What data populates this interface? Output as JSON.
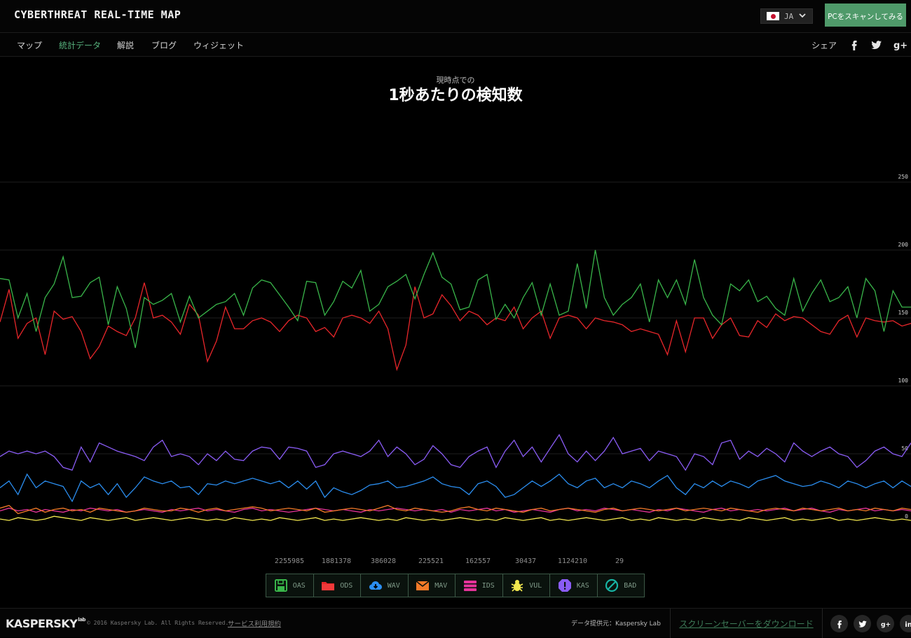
{
  "header": {
    "brand": "CYBERTHREAT REAL-TIME MAP",
    "language": "JA",
    "scan_button": "PCをスキャンしてみる"
  },
  "nav": {
    "items": [
      {
        "label": "マップ",
        "active": false
      },
      {
        "label": "統計データ",
        "active": true
      },
      {
        "label": "解説",
        "active": false
      },
      {
        "label": "ブログ",
        "active": false
      },
      {
        "label": "ウィジェット",
        "active": false
      }
    ],
    "share_label": "シェア",
    "share_icons": [
      "facebook-icon",
      "twitter-icon",
      "google-plus-icon"
    ]
  },
  "main": {
    "subtitle": "現時点での",
    "title": "1秒あたりの検知数"
  },
  "chart_data": {
    "type": "line",
    "title": "1秒あたりの検知数",
    "xlabel": "",
    "ylabel": "",
    "ylim": [
      0,
      260
    ],
    "yticks": [
      0,
      50,
      100,
      150,
      200,
      250
    ],
    "grid": true,
    "series": [
      {
        "name": "OAS",
        "color": "#39b54a",
        "values": [
          179,
          178,
          150,
          168,
          140,
          165,
          175,
          195,
          165,
          166,
          176,
          180,
          145,
          173,
          157,
          128,
          165,
          160,
          163,
          168,
          147,
          166,
          150,
          155,
          160,
          162,
          168,
          152,
          172,
          178,
          176,
          167,
          158,
          148,
          177,
          176,
          152,
          162,
          177,
          172,
          185,
          155,
          160,
          173,
          177,
          182,
          164,
          182,
          198,
          180,
          175,
          156,
          158,
          178,
          182,
          149,
          160,
          150,
          165,
          176,
          152,
          175,
          152,
          155,
          190,
          157,
          200,
          165,
          152,
          160,
          165,
          175,
          147,
          178,
          165,
          178,
          160,
          193,
          165,
          152,
          145,
          175,
          170,
          178,
          162,
          166,
          157,
          152,
          179,
          155,
          168,
          178,
          162,
          165,
          173,
          150,
          179,
          170,
          140,
          170,
          158,
          158
        ]
      },
      {
        "name": "ODS",
        "color": "#e8262a",
        "values": [
          147,
          171,
          135,
          146,
          150,
          123,
          155,
          149,
          151,
          140,
          120,
          129,
          144,
          140,
          137,
          150,
          176,
          150,
          152,
          147,
          138,
          160,
          152,
          118,
          133,
          158,
          142,
          142,
          148,
          150,
          147,
          140,
          148,
          152,
          150,
          140,
          143,
          136,
          150,
          152,
          150,
          146,
          155,
          142,
          112,
          130,
          173,
          150,
          153,
          167,
          159,
          148,
          155,
          152,
          145,
          150,
          148,
          158,
          142,
          150,
          155,
          135,
          150,
          152,
          150,
          142,
          150,
          148,
          147,
          145,
          140,
          142,
          140,
          138,
          123,
          148,
          125,
          150,
          150,
          135,
          145,
          150,
          137,
          136,
          148,
          143,
          153,
          148,
          151,
          150,
          145,
          140,
          138,
          148,
          152,
          136,
          150,
          148,
          147,
          148,
          144,
          146
        ]
      },
      {
        "name": "WAV",
        "color": "#2b8ef0",
        "values": [
          25,
          30,
          20,
          35,
          25,
          30,
          28,
          26,
          15,
          30,
          25,
          28,
          20,
          28,
          18,
          25,
          33,
          30,
          28,
          30,
          25,
          26,
          20,
          28,
          27,
          30,
          28,
          30,
          32,
          30,
          28,
          30,
          25,
          30,
          24,
          30,
          18,
          25,
          22,
          20,
          23,
          27,
          28,
          30,
          25,
          26,
          28,
          30,
          33,
          28,
          26,
          25,
          20,
          28,
          30,
          26,
          18,
          20,
          25,
          30,
          26,
          30,
          35,
          28,
          25,
          30,
          32,
          25,
          28,
          25,
          30,
          28,
          25,
          30,
          34,
          25,
          20,
          28,
          25,
          30,
          26,
          30,
          28,
          25,
          30,
          32,
          34,
          30,
          28,
          26,
          27,
          30,
          28,
          25,
          30,
          28,
          25,
          28,
          30,
          25,
          30,
          26
        ]
      },
      {
        "name": "MAV",
        "color": "#f47a28",
        "values": [
          10,
          12,
          6,
          8,
          10,
          7,
          9,
          10,
          8,
          9,
          7,
          10,
          9,
          8,
          7,
          8,
          10,
          9,
          8,
          8,
          10,
          9,
          7,
          9,
          10,
          8,
          9,
          10,
          11,
          10,
          8,
          9,
          10,
          9,
          8,
          10,
          7,
          8,
          9,
          10,
          9,
          8,
          10,
          12,
          9,
          8,
          10,
          9,
          8,
          7,
          8,
          10,
          11,
          9,
          8,
          10,
          9,
          8,
          7,
          9,
          10,
          8,
          9,
          10,
          9,
          8,
          7,
          9,
          10,
          8,
          9,
          10,
          9,
          8,
          9,
          10,
          8,
          9,
          10,
          9,
          8,
          10,
          9,
          8,
          7,
          9,
          10,
          9,
          8,
          10,
          9,
          8,
          9,
          10,
          8,
          9,
          8,
          10,
          9,
          8,
          10,
          9
        ]
      },
      {
        "name": "IDS",
        "color": "#e6339a",
        "values": [
          8,
          10,
          8,
          9,
          7,
          9,
          8,
          7,
          9,
          8,
          10,
          9,
          8,
          9,
          7,
          8,
          9,
          8,
          7,
          9,
          8,
          9,
          10,
          8,
          9,
          8,
          7,
          9,
          10,
          8,
          9,
          8,
          7,
          8,
          9,
          10,
          9,
          8,
          9,
          8,
          7,
          9,
          8,
          9,
          10,
          9,
          8,
          9,
          8,
          9,
          7,
          9,
          8,
          9,
          10,
          8,
          9,
          7,
          8,
          9,
          8,
          7,
          9,
          10,
          8,
          9,
          8,
          10,
          9,
          8,
          9,
          8,
          7,
          9,
          8,
          10,
          9,
          8,
          7,
          9,
          10,
          8,
          9,
          8,
          9,
          8,
          9,
          10,
          8,
          9,
          10,
          8,
          7,
          9,
          8,
          9,
          10,
          8,
          9,
          8,
          9,
          8
        ]
      },
      {
        "name": "VUL",
        "color": "#f3e84e",
        "values": [
          2,
          1,
          3,
          2,
          1,
          2,
          4,
          3,
          2,
          1,
          3,
          2,
          1,
          2,
          3,
          1,
          2,
          3,
          2,
          1,
          2,
          3,
          2,
          1,
          2,
          1,
          3,
          2,
          1,
          2,
          1,
          3,
          2,
          1,
          2,
          3,
          1,
          2,
          1,
          2,
          3,
          2,
          1,
          2,
          1,
          3,
          2,
          1,
          2,
          1,
          2,
          3,
          2,
          1,
          2,
          1,
          3,
          2,
          1,
          2,
          3,
          1,
          2,
          1,
          2,
          3,
          2,
          1,
          2,
          3,
          1,
          2,
          1,
          3,
          2,
          1,
          2,
          1,
          3,
          2,
          1,
          2,
          1,
          3,
          2,
          1,
          2,
          3,
          1,
          2,
          1,
          2,
          3,
          1,
          2,
          1,
          2,
          3,
          2,
          1,
          2,
          1
        ]
      },
      {
        "name": "KAS",
        "color": "#8a5cf5",
        "values": [
          48,
          52,
          50,
          52,
          50,
          52,
          48,
          40,
          38,
          55,
          44,
          58,
          55,
          52,
          50,
          48,
          45,
          55,
          60,
          48,
          50,
          48,
          42,
          50,
          45,
          52,
          46,
          45,
          52,
          55,
          54,
          46,
          55,
          54,
          52,
          40,
          42,
          50,
          52,
          50,
          48,
          52,
          60,
          48,
          55,
          50,
          42,
          46,
          56,
          50,
          42,
          40,
          48,
          52,
          55,
          40,
          52,
          60,
          48,
          55,
          44,
          54,
          64,
          50,
          44,
          52,
          45,
          52,
          62,
          50,
          52,
          54,
          45,
          52,
          50,
          48,
          38,
          50,
          48,
          42,
          58,
          60,
          46,
          52,
          48,
          54,
          50,
          44,
          58,
          52,
          48,
          52,
          55,
          50,
          48,
          40,
          45,
          52,
          55,
          50,
          48,
          58
        ]
      },
      {
        "name": "BAD",
        "color": "#18b3a3",
        "values": [
          0,
          0,
          0,
          0,
          0,
          0,
          0,
          0,
          0,
          0,
          0,
          0,
          0,
          0,
          0,
          0,
          0,
          0,
          0,
          0,
          0,
          0,
          0,
          0,
          0,
          0,
          0,
          0,
          0,
          0,
          0,
          0,
          0,
          0,
          0,
          0,
          0,
          0,
          0,
          0,
          0,
          0,
          0,
          0,
          0,
          0,
          0,
          0,
          0,
          0,
          0,
          0,
          0,
          0,
          0,
          0,
          0,
          0,
          0,
          0,
          0,
          0,
          0,
          0,
          0,
          0,
          0,
          0,
          0,
          0,
          0,
          0,
          0,
          0,
          0,
          0,
          0,
          0,
          0,
          0,
          0,
          0,
          0,
          0,
          0,
          0,
          0,
          0,
          0,
          0,
          0,
          0,
          0,
          0,
          0,
          0,
          0,
          0,
          0,
          0,
          0,
          0
        ]
      }
    ]
  },
  "legend": [
    {
      "label": "OAS",
      "count": "2255985",
      "icon": "floppy-disk-icon",
      "color": "#39b54a"
    },
    {
      "label": "ODS",
      "count": "1881378",
      "icon": "folder-icon",
      "color": "#e8262a"
    },
    {
      "label": "WAV",
      "count": "386028",
      "icon": "cloud-download-icon",
      "color": "#2b8ef0"
    },
    {
      "label": "MAV",
      "count": "225521",
      "icon": "envelope-icon",
      "color": "#f47a28"
    },
    {
      "label": "IDS",
      "count": "162557",
      "icon": "server-icon",
      "color": "#e6339a"
    },
    {
      "label": "VUL",
      "count": "30437",
      "icon": "bug-icon",
      "color": "#f3e84e"
    },
    {
      "label": "KAS",
      "count": "1124210",
      "icon": "exclamation-icon",
      "color": "#8a5cf5"
    },
    {
      "label": "BAD",
      "count": "29",
      "icon": "blocked-icon",
      "color": "#18b3a3"
    }
  ],
  "footer": {
    "logo": "KASPERSKY",
    "logo_suffix": "lab",
    "copyright": "© 2016 Kaspersky Lab. All Rights Reserved.",
    "terms": "サービス利用規約",
    "provider": "データ提供元：Kaspersky Lab",
    "screensaver": "スクリーンセーバーをダウンロード",
    "social_icons": [
      "facebook-icon",
      "twitter-icon",
      "google-plus-icon",
      "linkedin-icon"
    ]
  }
}
